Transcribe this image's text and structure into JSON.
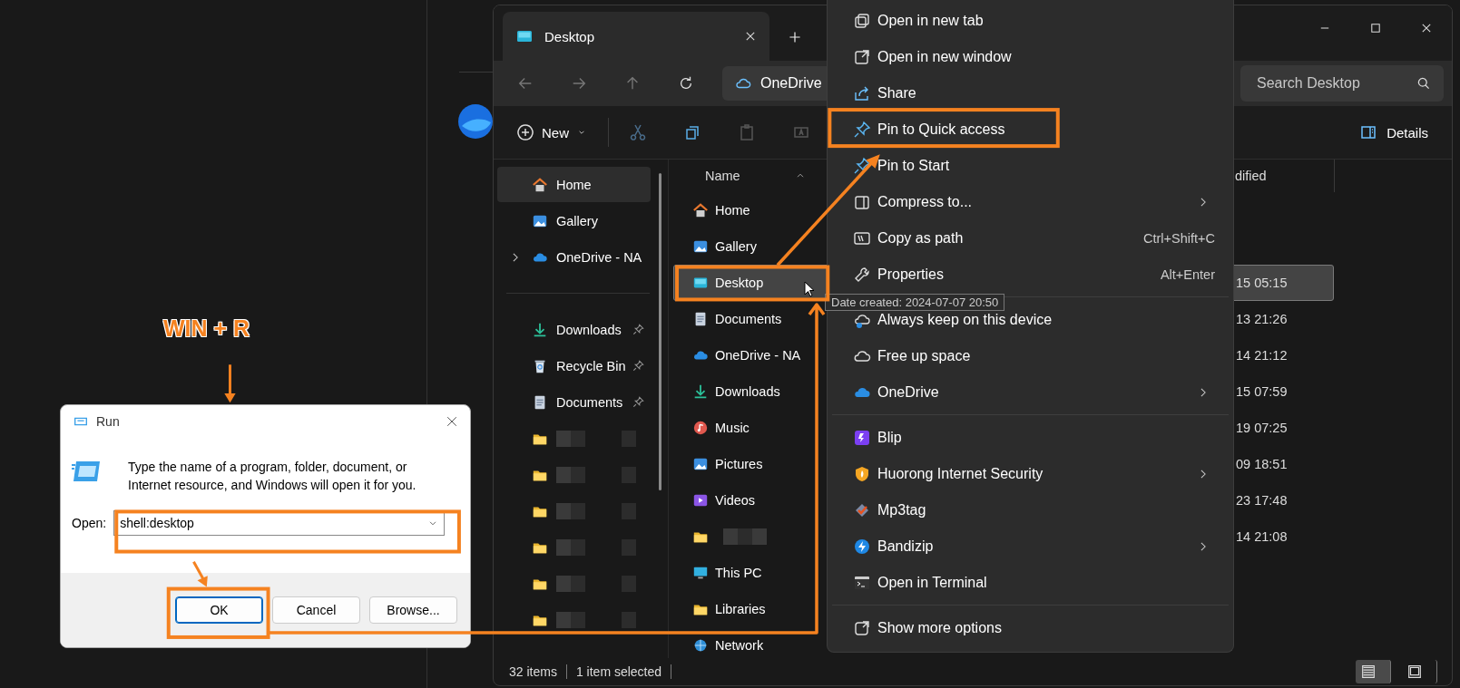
{
  "annotation": {
    "shortcut_label": "WIN + R"
  },
  "explorer": {
    "tab": {
      "title": "Desktop"
    },
    "address": "OneDrive",
    "search": {
      "placeholder": "Search Desktop"
    },
    "toolbar": {
      "new_label": "New",
      "details_label": "Details"
    },
    "nav": [
      {
        "kind": "home",
        "label": "Home",
        "selected": true,
        "pinned": false,
        "expandable": false
      },
      {
        "kind": "gallery",
        "label": "Gallery",
        "selected": false,
        "pinned": false,
        "expandable": false
      },
      {
        "kind": "onedrive",
        "label": "OneDrive - NA",
        "selected": false,
        "pinned": false,
        "expandable": true
      },
      {
        "kind": "divider"
      },
      {
        "kind": "downloads",
        "label": "Downloads",
        "selected": false,
        "pinned": true,
        "expandable": false
      },
      {
        "kind": "recycle",
        "label": "Recycle Bin",
        "selected": false,
        "pinned": true,
        "expandable": false
      },
      {
        "kind": "documents",
        "label": "Documents",
        "selected": false,
        "pinned": true,
        "expandable": false
      },
      {
        "kind": "blurred",
        "selected": false,
        "pinned": false,
        "expandable": false
      },
      {
        "kind": "blurred",
        "selected": false,
        "pinned": false,
        "expandable": false
      },
      {
        "kind": "blurred",
        "selected": false,
        "pinned": false,
        "expandable": false
      },
      {
        "kind": "blurred",
        "selected": false,
        "pinned": false,
        "expandable": false
      },
      {
        "kind": "blurred",
        "selected": false,
        "pinned": false,
        "expandable": false
      },
      {
        "kind": "blurred",
        "selected": false,
        "pinned": false,
        "expandable": false
      }
    ],
    "columns": [
      "Name",
      "dified"
    ],
    "files": [
      {
        "kind": "home",
        "name": "Home",
        "selected": false
      },
      {
        "kind": "gallery",
        "name": "Gallery",
        "selected": false
      },
      {
        "kind": "desktop",
        "name": "Desktop",
        "date": "15 05:15",
        "selected": true
      },
      {
        "kind": "documents",
        "name": "Documents",
        "date": "13 21:26",
        "selected": false
      },
      {
        "kind": "onedrive",
        "name": "OneDrive - NA",
        "date": "14 21:12",
        "selected": false
      },
      {
        "kind": "downloads",
        "name": "Downloads",
        "date": "15 07:59",
        "selected": false
      },
      {
        "kind": "music",
        "name": "Music",
        "date": "19 07:25",
        "selected": false
      },
      {
        "kind": "pictures",
        "name": "Pictures",
        "date": "09 18:51",
        "selected": false
      },
      {
        "kind": "videos",
        "name": "Videos",
        "date": "23 17:48",
        "selected": false
      },
      {
        "kind": "blurred",
        "date": "14 21:08",
        "selected": false
      },
      {
        "kind": "pc",
        "name": "This PC",
        "selected": false
      },
      {
        "kind": "libraries",
        "name": "Libraries",
        "selected": false
      },
      {
        "kind": "network",
        "name": "Network",
        "selected": false
      }
    ],
    "status": [
      "32 items",
      "1 item selected"
    ],
    "views": [
      {
        "kind": "details",
        "selected": true
      },
      {
        "kind": "tiles",
        "selected": false
      }
    ]
  },
  "context_menu": {
    "groups": [
      {
        "items": [
          {
            "kind": "tab",
            "label": "Open in new tab",
            "submenu": false
          },
          {
            "kind": "window",
            "label": "Open in new window",
            "submenu": false
          },
          {
            "kind": "share",
            "label": "Share",
            "submenu": false
          },
          {
            "kind": "pin",
            "label": "Pin to Quick access",
            "submenu": false
          },
          {
            "kind": "pin",
            "label": "Pin to Start",
            "submenu": false
          },
          {
            "kind": "compress",
            "label": "Compress to...",
            "submenu": true
          },
          {
            "kind": "path",
            "label": "Copy as path",
            "shortcut": "Ctrl+Shift+C",
            "submenu": false
          },
          {
            "kind": "properties",
            "label": "Properties",
            "shortcut": "Alt+Enter",
            "submenu": false
          }
        ]
      },
      {
        "items": [
          {
            "kind": "keep",
            "label": "Always keep on this device",
            "submenu": false
          },
          {
            "kind": "free",
            "label": "Free up space",
            "submenu": false
          },
          {
            "kind": "onedrive",
            "label": "OneDrive",
            "submenu": true
          }
        ]
      },
      {
        "items": [
          {
            "kind": "blip",
            "label": "Blip",
            "submenu": false
          },
          {
            "kind": "huorong",
            "label": "Huorong Internet Security",
            "submenu": true
          },
          {
            "kind": "mp3tag",
            "label": "Mp3tag",
            "submenu": false
          },
          {
            "kind": "bandizip",
            "label": "Bandizip",
            "submenu": true
          },
          {
            "kind": "terminal",
            "label": "Open in Terminal",
            "submenu": false
          }
        ]
      },
      {
        "items": [
          {
            "kind": "more",
            "label": "Show more options",
            "submenu": false
          }
        ]
      }
    ]
  },
  "tooltip": "Date created: 2024-07-07 20:50",
  "run_dialog": {
    "title": "Run",
    "message": "Type the name of a program, folder, document, or Internet resource, and Windows will open it for you.",
    "open_label": "Open:",
    "value": "shell:desktop",
    "buttons": [
      {
        "label": "OK",
        "default": true
      },
      {
        "label": "Cancel",
        "default": false
      },
      {
        "label": "Browse...",
        "default": false
      }
    ]
  }
}
